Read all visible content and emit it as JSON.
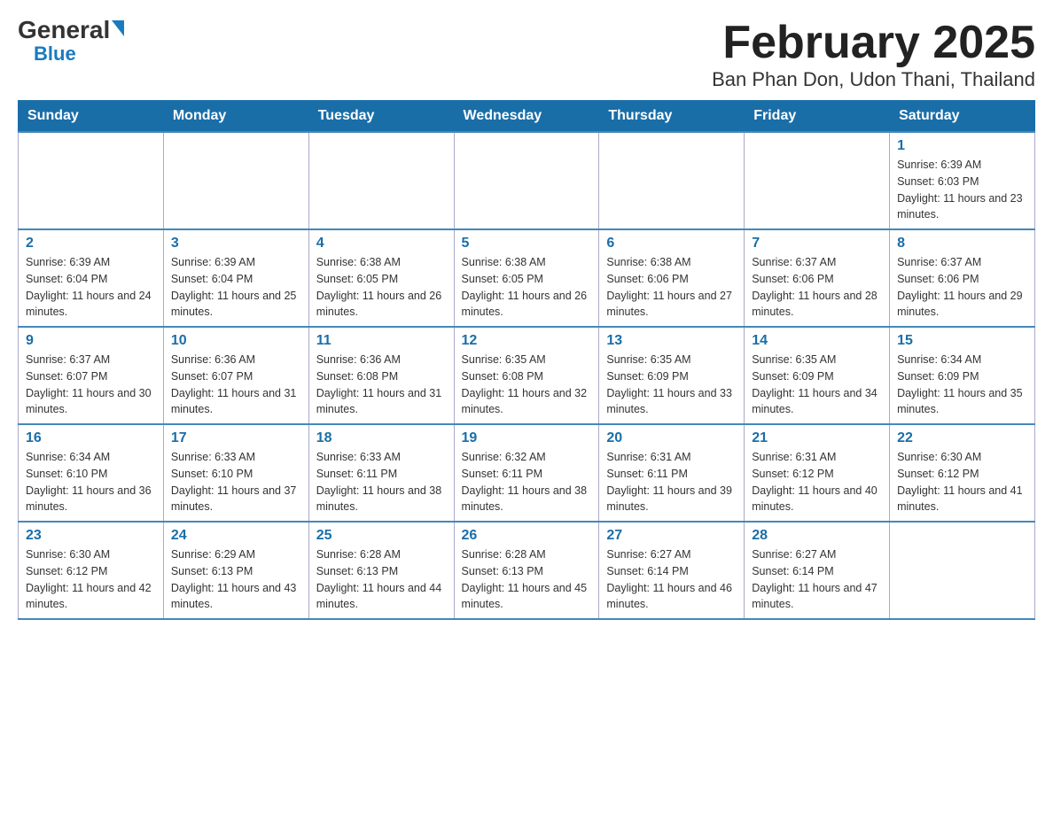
{
  "header": {
    "logo_general": "General",
    "logo_blue": "Blue",
    "month_title": "February 2025",
    "location": "Ban Phan Don, Udon Thani, Thailand"
  },
  "weekdays": [
    "Sunday",
    "Monday",
    "Tuesday",
    "Wednesday",
    "Thursday",
    "Friday",
    "Saturday"
  ],
  "weeks": [
    [
      {
        "day": "",
        "sunrise": "",
        "sunset": "",
        "daylight": ""
      },
      {
        "day": "",
        "sunrise": "",
        "sunset": "",
        "daylight": ""
      },
      {
        "day": "",
        "sunrise": "",
        "sunset": "",
        "daylight": ""
      },
      {
        "day": "",
        "sunrise": "",
        "sunset": "",
        "daylight": ""
      },
      {
        "day": "",
        "sunrise": "",
        "sunset": "",
        "daylight": ""
      },
      {
        "day": "",
        "sunrise": "",
        "sunset": "",
        "daylight": ""
      },
      {
        "day": "1",
        "sunrise": "Sunrise: 6:39 AM",
        "sunset": "Sunset: 6:03 PM",
        "daylight": "Daylight: 11 hours and 23 minutes."
      }
    ],
    [
      {
        "day": "2",
        "sunrise": "Sunrise: 6:39 AM",
        "sunset": "Sunset: 6:04 PM",
        "daylight": "Daylight: 11 hours and 24 minutes."
      },
      {
        "day": "3",
        "sunrise": "Sunrise: 6:39 AM",
        "sunset": "Sunset: 6:04 PM",
        "daylight": "Daylight: 11 hours and 25 minutes."
      },
      {
        "day": "4",
        "sunrise": "Sunrise: 6:38 AM",
        "sunset": "Sunset: 6:05 PM",
        "daylight": "Daylight: 11 hours and 26 minutes."
      },
      {
        "day": "5",
        "sunrise": "Sunrise: 6:38 AM",
        "sunset": "Sunset: 6:05 PM",
        "daylight": "Daylight: 11 hours and 26 minutes."
      },
      {
        "day": "6",
        "sunrise": "Sunrise: 6:38 AM",
        "sunset": "Sunset: 6:06 PM",
        "daylight": "Daylight: 11 hours and 27 minutes."
      },
      {
        "day": "7",
        "sunrise": "Sunrise: 6:37 AM",
        "sunset": "Sunset: 6:06 PM",
        "daylight": "Daylight: 11 hours and 28 minutes."
      },
      {
        "day": "8",
        "sunrise": "Sunrise: 6:37 AM",
        "sunset": "Sunset: 6:06 PM",
        "daylight": "Daylight: 11 hours and 29 minutes."
      }
    ],
    [
      {
        "day": "9",
        "sunrise": "Sunrise: 6:37 AM",
        "sunset": "Sunset: 6:07 PM",
        "daylight": "Daylight: 11 hours and 30 minutes."
      },
      {
        "day": "10",
        "sunrise": "Sunrise: 6:36 AM",
        "sunset": "Sunset: 6:07 PM",
        "daylight": "Daylight: 11 hours and 31 minutes."
      },
      {
        "day": "11",
        "sunrise": "Sunrise: 6:36 AM",
        "sunset": "Sunset: 6:08 PM",
        "daylight": "Daylight: 11 hours and 31 minutes."
      },
      {
        "day": "12",
        "sunrise": "Sunrise: 6:35 AM",
        "sunset": "Sunset: 6:08 PM",
        "daylight": "Daylight: 11 hours and 32 minutes."
      },
      {
        "day": "13",
        "sunrise": "Sunrise: 6:35 AM",
        "sunset": "Sunset: 6:09 PM",
        "daylight": "Daylight: 11 hours and 33 minutes."
      },
      {
        "day": "14",
        "sunrise": "Sunrise: 6:35 AM",
        "sunset": "Sunset: 6:09 PM",
        "daylight": "Daylight: 11 hours and 34 minutes."
      },
      {
        "day": "15",
        "sunrise": "Sunrise: 6:34 AM",
        "sunset": "Sunset: 6:09 PM",
        "daylight": "Daylight: 11 hours and 35 minutes."
      }
    ],
    [
      {
        "day": "16",
        "sunrise": "Sunrise: 6:34 AM",
        "sunset": "Sunset: 6:10 PM",
        "daylight": "Daylight: 11 hours and 36 minutes."
      },
      {
        "day": "17",
        "sunrise": "Sunrise: 6:33 AM",
        "sunset": "Sunset: 6:10 PM",
        "daylight": "Daylight: 11 hours and 37 minutes."
      },
      {
        "day": "18",
        "sunrise": "Sunrise: 6:33 AM",
        "sunset": "Sunset: 6:11 PM",
        "daylight": "Daylight: 11 hours and 38 minutes."
      },
      {
        "day": "19",
        "sunrise": "Sunrise: 6:32 AM",
        "sunset": "Sunset: 6:11 PM",
        "daylight": "Daylight: 11 hours and 38 minutes."
      },
      {
        "day": "20",
        "sunrise": "Sunrise: 6:31 AM",
        "sunset": "Sunset: 6:11 PM",
        "daylight": "Daylight: 11 hours and 39 minutes."
      },
      {
        "day": "21",
        "sunrise": "Sunrise: 6:31 AM",
        "sunset": "Sunset: 6:12 PM",
        "daylight": "Daylight: 11 hours and 40 minutes."
      },
      {
        "day": "22",
        "sunrise": "Sunrise: 6:30 AM",
        "sunset": "Sunset: 6:12 PM",
        "daylight": "Daylight: 11 hours and 41 minutes."
      }
    ],
    [
      {
        "day": "23",
        "sunrise": "Sunrise: 6:30 AM",
        "sunset": "Sunset: 6:12 PM",
        "daylight": "Daylight: 11 hours and 42 minutes."
      },
      {
        "day": "24",
        "sunrise": "Sunrise: 6:29 AM",
        "sunset": "Sunset: 6:13 PM",
        "daylight": "Daylight: 11 hours and 43 minutes."
      },
      {
        "day": "25",
        "sunrise": "Sunrise: 6:28 AM",
        "sunset": "Sunset: 6:13 PM",
        "daylight": "Daylight: 11 hours and 44 minutes."
      },
      {
        "day": "26",
        "sunrise": "Sunrise: 6:28 AM",
        "sunset": "Sunset: 6:13 PM",
        "daylight": "Daylight: 11 hours and 45 minutes."
      },
      {
        "day": "27",
        "sunrise": "Sunrise: 6:27 AM",
        "sunset": "Sunset: 6:14 PM",
        "daylight": "Daylight: 11 hours and 46 minutes."
      },
      {
        "day": "28",
        "sunrise": "Sunrise: 6:27 AM",
        "sunset": "Sunset: 6:14 PM",
        "daylight": "Daylight: 11 hours and 47 minutes."
      },
      {
        "day": "",
        "sunrise": "",
        "sunset": "",
        "daylight": ""
      }
    ]
  ]
}
